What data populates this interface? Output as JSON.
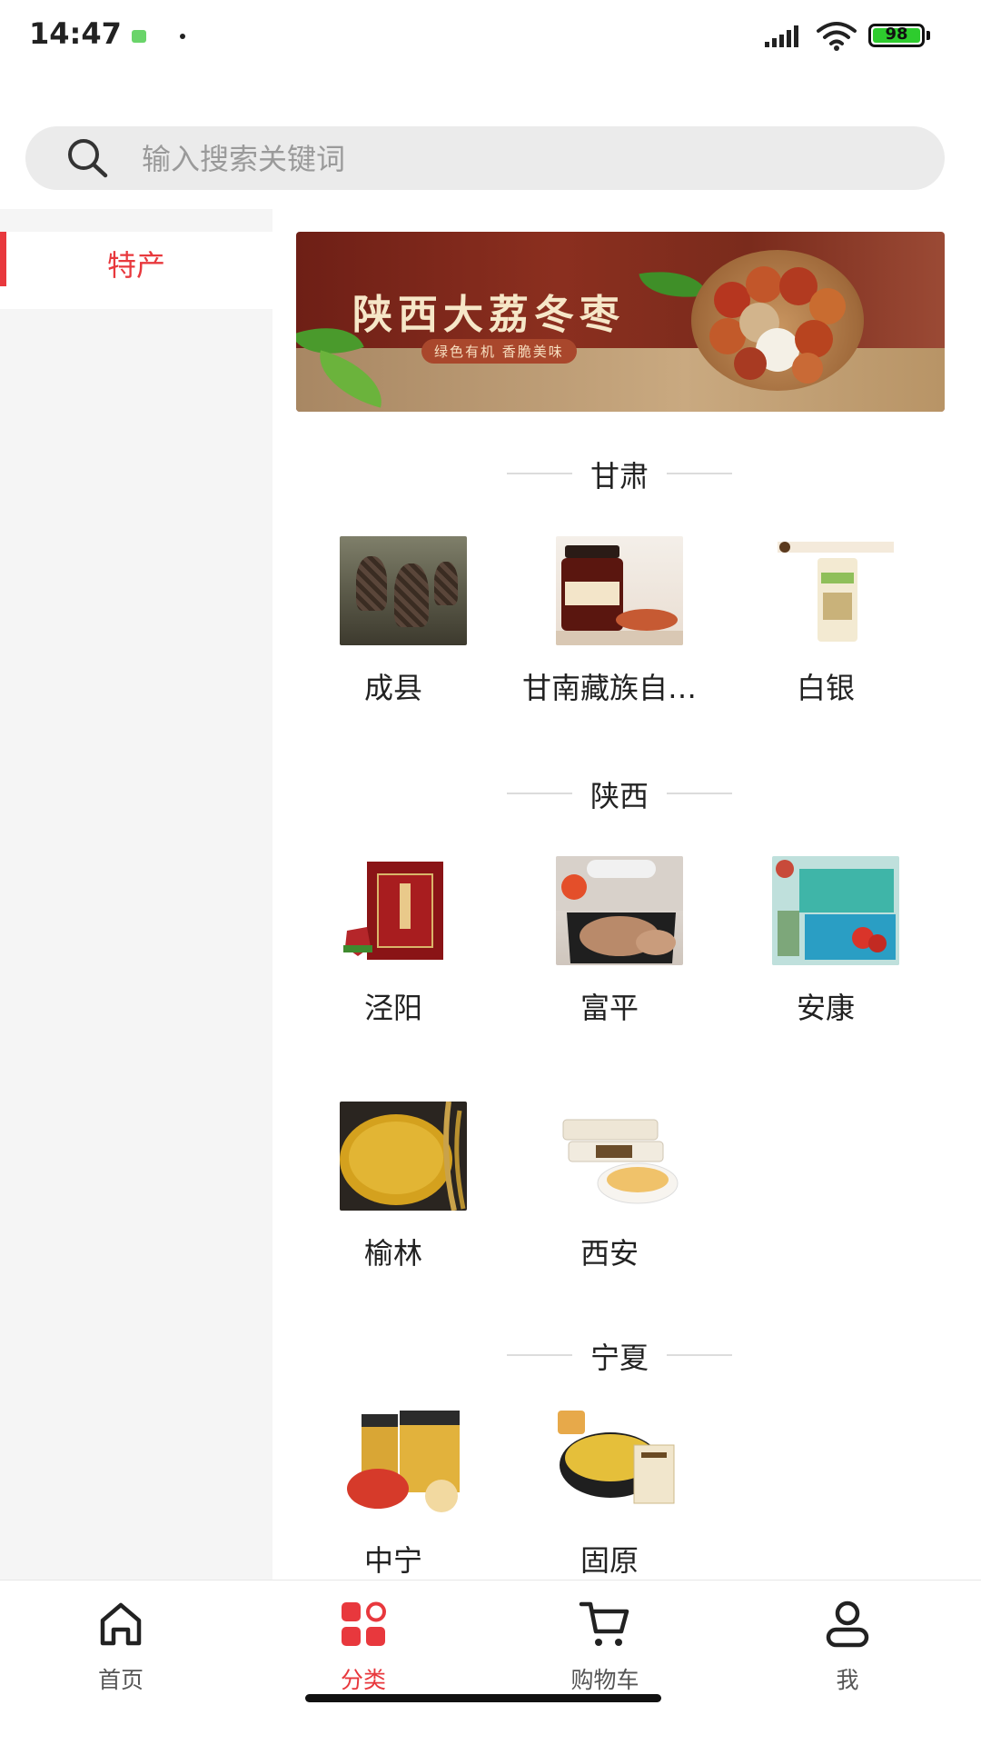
{
  "status_bar": {
    "time": "14:47",
    "battery": "98"
  },
  "search": {
    "placeholder": "输入搜索关键词"
  },
  "sidebar": {
    "items": [
      {
        "label": "特产",
        "active": true
      }
    ]
  },
  "banner": {
    "title": "陕西大荔冬枣",
    "subtitle": "绿色有机 香脆美味"
  },
  "sections": [
    {
      "title": "甘肃",
      "items": [
        {
          "label": "成县",
          "image": "morel-mushroom"
        },
        {
          "label": "甘南藏族自…",
          "image": "chili-jar"
        },
        {
          "label": "白银",
          "image": "rice-bag"
        }
      ]
    },
    {
      "title": "陕西",
      "items": [
        {
          "label": "泾阳",
          "image": "tea-gift-box"
        },
        {
          "label": "富平",
          "image": "dried-persimmon"
        },
        {
          "label": "安康",
          "image": "gift-boxes"
        },
        {
          "label": "榆林",
          "image": "millet"
        },
        {
          "label": "西安",
          "image": "cake-snack"
        }
      ]
    },
    {
      "title": "宁夏",
      "items": [
        {
          "label": "中宁",
          "image": "goji-jars"
        },
        {
          "label": "固原",
          "image": "millet-bowl"
        }
      ]
    }
  ],
  "bottom_nav": {
    "items": [
      {
        "label": "首页",
        "icon": "home-icon",
        "active": false
      },
      {
        "label": "分类",
        "icon": "category-icon",
        "active": true
      },
      {
        "label": "购物车",
        "icon": "cart-icon",
        "active": false
      },
      {
        "label": "我",
        "icon": "user-icon",
        "active": false
      }
    ]
  },
  "colors": {
    "accent": "#e8383d",
    "sidebar_bg": "#f5f5f5",
    "search_bg": "#ebebeb"
  }
}
